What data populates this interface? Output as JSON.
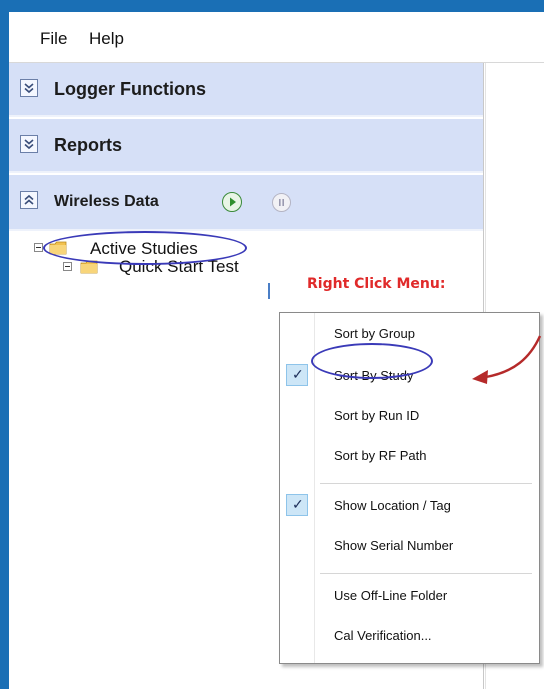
{
  "menubar": {
    "file": "File",
    "help": "Help"
  },
  "panels": {
    "logger": "Logger Functions",
    "reports": "Reports",
    "wireless": "Wireless Data"
  },
  "tree": {
    "root": "Active Studies",
    "child": "Quick Start Test"
  },
  "annotation": {
    "label": "Right Click Menu:",
    "color": "#e02a2a",
    "arrow_color": "#b52a2a",
    "oval_color": "#3a3ab8"
  },
  "context_menu": {
    "items": [
      {
        "label": "Sort by Group",
        "checked": false
      },
      {
        "label": "Sort By Study",
        "checked": true
      },
      {
        "label": "Sort by Run ID",
        "checked": false
      },
      {
        "label": "Sort by RF Path",
        "checked": false
      },
      {
        "label": "Show Location / Tag",
        "checked": true
      },
      {
        "label": "Show Serial Number",
        "checked": false
      },
      {
        "label": "Use Off-Line Folder",
        "checked": false
      },
      {
        "label": "Cal Verification...",
        "checked": false
      }
    ],
    "check_glyph": "✓"
  },
  "icons": {
    "expand": "double-chevron-down-icon",
    "collapse": "double-chevron-up-icon",
    "play": "play-icon",
    "pause": "pause-icon",
    "folder": "folder-icon"
  },
  "colors": {
    "frame": "#1a6fb5",
    "panel_header": "#d6e0f7",
    "highlight": "#cde6f7"
  }
}
